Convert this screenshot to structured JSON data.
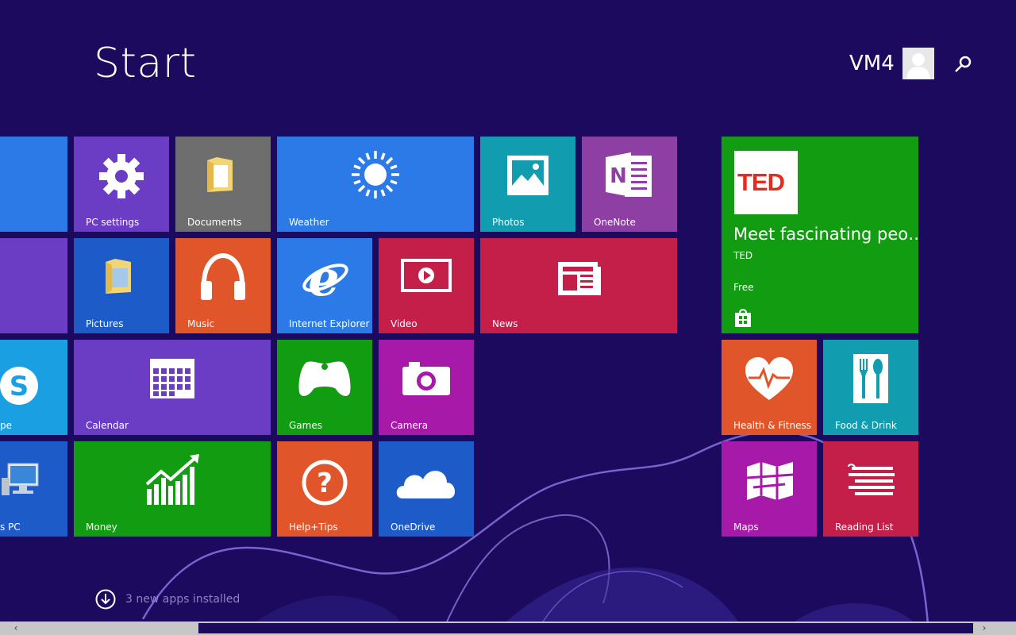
{
  "title": "Start",
  "user": {
    "name": "VM4",
    "avatar_icon": "person-icon"
  },
  "search": {
    "icon": "search-icon"
  },
  "colors": {
    "background": "#1b0a5e",
    "blue": "#2b7ae8",
    "purple": "#6b3cc4",
    "gray": "#6e6e6e",
    "orange": "#e0562a",
    "red": "#c41f48",
    "green": "#119c11",
    "magenta": "#a719a8",
    "teal": "#119cb0"
  },
  "tiles": {
    "partial1": {
      "label": ""
    },
    "partial2": {
      "label": ""
    },
    "skype": {
      "label": "pe",
      "icon": "skype-icon"
    },
    "this_pc": {
      "label": "s PC",
      "icon": "computer-icon"
    },
    "pc_settings": {
      "label": "PC settings",
      "icon": "gear-icon"
    },
    "documents": {
      "label": "Documents",
      "icon": "folder-icon"
    },
    "weather": {
      "label": "Weather",
      "icon": "sun-icon"
    },
    "photos": {
      "label": "Photos",
      "icon": "photo-icon"
    },
    "onenote": {
      "label": "OneNote",
      "icon": "onenote-icon"
    },
    "pictures": {
      "label": "Pictures",
      "icon": "folder-icon"
    },
    "music": {
      "label": "Music",
      "icon": "headphones-icon"
    },
    "ie": {
      "label": "Internet Explorer",
      "icon": "ie-icon"
    },
    "video": {
      "label": "Video",
      "icon": "play-icon"
    },
    "news": {
      "label": "News",
      "icon": "newspaper-icon"
    },
    "calendar": {
      "label": "Calendar",
      "icon": "calendar-icon"
    },
    "games": {
      "label": "Games",
      "icon": "gamepad-icon"
    },
    "camera": {
      "label": "Camera",
      "icon": "camera-icon"
    },
    "money": {
      "label": "Money",
      "icon": "chart-icon"
    },
    "helptips": {
      "label": "Help+Tips",
      "icon": "question-icon"
    },
    "onedrive": {
      "label": "OneDrive",
      "icon": "cloud-icon"
    },
    "ted": {
      "logo": "TED",
      "text": "Meet fascinating peo…",
      "publisher": "TED",
      "price": "Free",
      "icon": "store-icon"
    },
    "health": {
      "label": "Health & Fitness",
      "icon": "heart-icon"
    },
    "food": {
      "label": "Food & Drink",
      "icon": "cutlery-icon"
    },
    "maps": {
      "label": "Maps",
      "icon": "map-icon"
    },
    "reading": {
      "label": "Reading List",
      "icon": "list-icon"
    }
  },
  "notification": {
    "text": "3 new apps installed",
    "icon": "download-arrow-icon"
  },
  "scrollbar": {
    "left": "‹",
    "right": "›"
  }
}
